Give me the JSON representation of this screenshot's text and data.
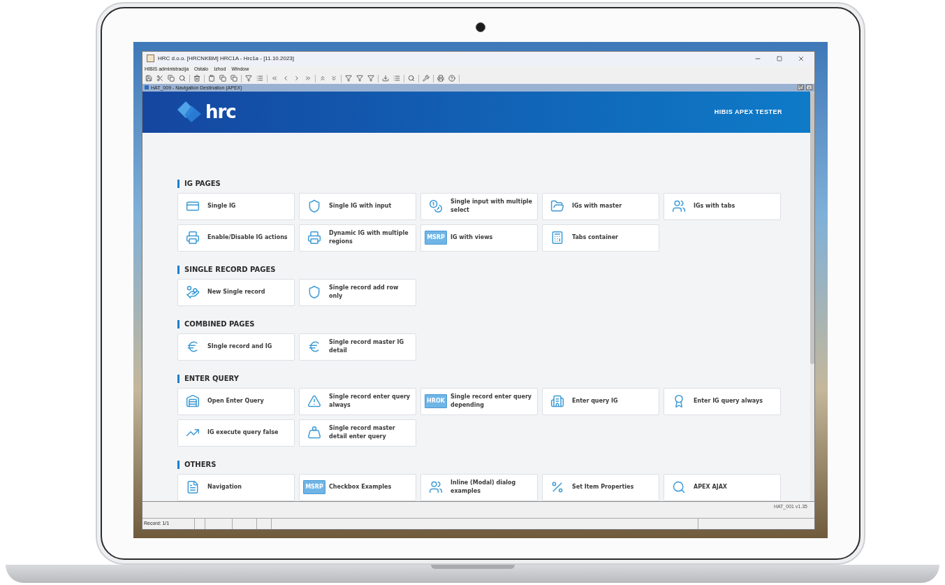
{
  "window": {
    "title": "HRC d.o.o. [HRCNKBM] HRC1A - Hrc1a - [11.10.2023]"
  },
  "menu": [
    "HIBIS administracija",
    "Ostalo",
    "Izhod",
    "Window"
  ],
  "frame": {
    "title": "HAT_009 - Navigation Destination (APEX)"
  },
  "header": {
    "logo": "hrc",
    "title": "HIBIS APEX TESTER"
  },
  "sections": [
    {
      "title": "IG PAGES",
      "items": [
        {
          "label": "Single IG"
        },
        {
          "label": "Single IG with input"
        },
        {
          "label": "Single input with multiple select"
        },
        {
          "label": "IGs with master"
        },
        {
          "label": "IGs with tabs"
        },
        {
          "label": "Enable/Disable IG actions"
        },
        {
          "label": "Dynamic IG with multiple regions"
        },
        {
          "label": "IG with views",
          "badge": "MSRP"
        },
        {
          "label": "Tabs container"
        }
      ]
    },
    {
      "title": "SINGLE RECORD PAGES",
      "items": [
        {
          "label": "New Single record"
        },
        {
          "label": "Single record add row only"
        }
      ]
    },
    {
      "title": "COMBINED PAGES",
      "items": [
        {
          "label": "SIngle record and IG"
        },
        {
          "label": "Single record master IG detail"
        }
      ]
    },
    {
      "title": "ENTER QUERY",
      "items": [
        {
          "label": "Open Enter Query"
        },
        {
          "label": "Single record enter query always"
        },
        {
          "label": "Single record enter query depending",
          "badge": "HROK"
        },
        {
          "label": "Enter query IG"
        },
        {
          "label": "Enter IG query always"
        },
        {
          "label": "IG execute query false"
        },
        {
          "label": "Single record master detail enter query"
        }
      ]
    },
    {
      "title": "OTHERS",
      "items": [
        {
          "label": "Navigation"
        },
        {
          "label": "Checkbox Examples",
          "badge": "MSRP"
        },
        {
          "label": "Inline (Modal) dialog examples"
        },
        {
          "label": "Set Item Properties"
        },
        {
          "label": "APEX AJAX"
        }
      ]
    }
  ],
  "footer": {
    "version": "HAT_001 v1.35"
  },
  "status_bar": {
    "record": "Record: 1/1"
  }
}
